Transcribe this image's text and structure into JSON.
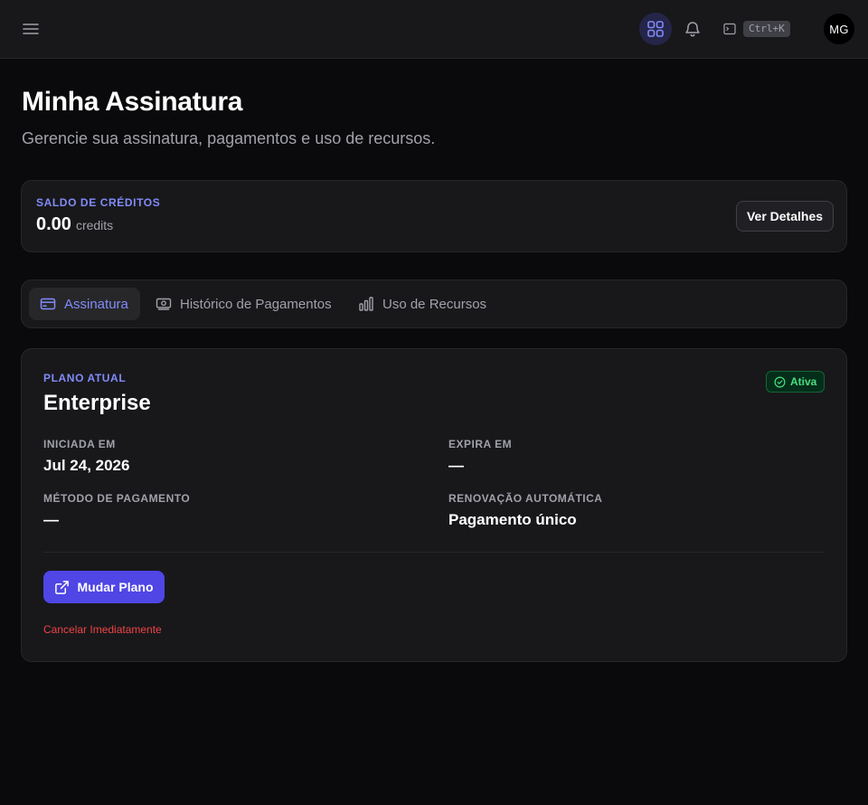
{
  "header": {
    "command_shortcut": "Ctrl+K",
    "avatar_initials": "MG",
    "icons": [
      "menu-icon",
      "apps-grid-icon",
      "bell-icon",
      "terminal-icon"
    ]
  },
  "page": {
    "title": "Minha Assinatura",
    "subtitle": "Gerencie sua assinatura, pagamentos e uso de recursos."
  },
  "credits": {
    "label": "SALDO DE CRÉDITOS",
    "value": "0.00",
    "unit": "credits",
    "details_button": "Ver Detalhes"
  },
  "tabs": [
    {
      "label": "Assinatura",
      "icon": "credit-card-icon",
      "active": true
    },
    {
      "label": "Histórico de Pagamentos",
      "icon": "banknote-icon",
      "active": false
    },
    {
      "label": "Uso de Recursos",
      "icon": "bar-chart-icon",
      "active": false
    }
  ],
  "plan": {
    "label": "PLANO ATUAL",
    "name": "Enterprise",
    "status": "Ativa",
    "fields": {
      "started_label": "INICIADA EM",
      "started_value": "Jul 24, 2026",
      "expires_label": "EXPIRA EM",
      "expires_value": "—",
      "payment_label": "MÉTODO DE PAGAMENTO",
      "payment_value": "—",
      "renewal_label": "RENOVAÇÃO AUTOMÁTICA",
      "renewal_value": "Pagamento único"
    },
    "change_button": "Mudar Plano",
    "cancel_link": "Cancelar Imediatamente"
  },
  "colors": {
    "background": "#0a0a0c",
    "surface": "#18181b",
    "border": "#27272a",
    "accent": "#818cf8",
    "primary_button": "#4f46e5",
    "success": "#4ade80",
    "danger": "#ef4444"
  }
}
